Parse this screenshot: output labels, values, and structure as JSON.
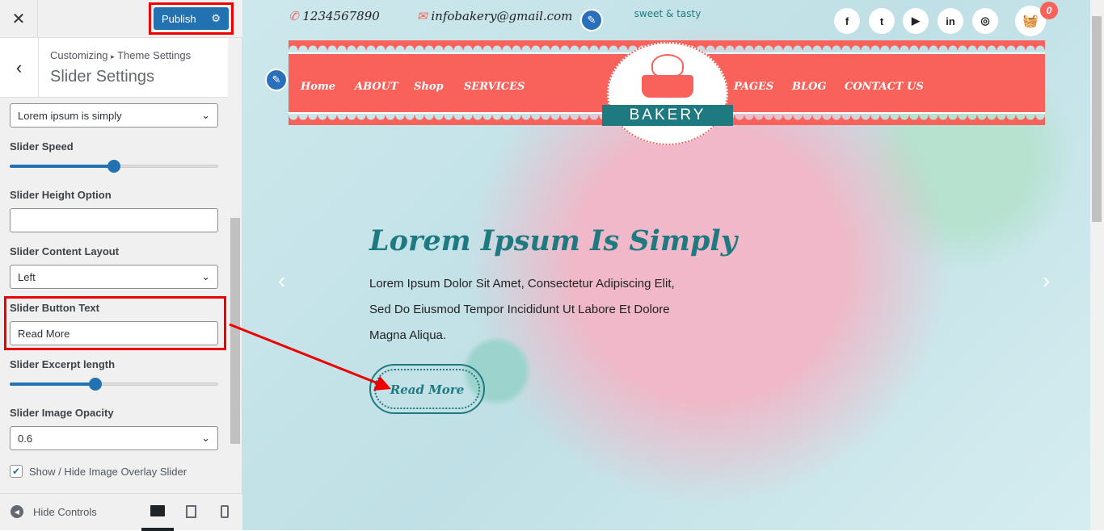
{
  "customizer": {
    "close_label": "✕",
    "publish_label": "Publish",
    "breadcrumb_root": "Customizing",
    "breadcrumb_sep": "▸",
    "breadcrumb_parent": "Theme Settings",
    "section_title": "Slider Settings",
    "top_select_value": "Lorem ipsum is simply",
    "slider_speed_label": "Slider Speed",
    "slider_speed_percent": 50,
    "slider_height_label": "Slider Height Option",
    "slider_height_value": "",
    "content_layout_label": "Slider Content Layout",
    "content_layout_value": "Left",
    "button_text_label": "Slider Button Text",
    "button_text_value": "Read More",
    "excerpt_label": "Slider Excerpt length",
    "excerpt_percent": 41,
    "opacity_label": "Slider Image Opacity",
    "opacity_value": "0.6",
    "overlay_label": "Show / Hide Image Overlay Slider",
    "overlay_checked": true,
    "hide_controls_label": "Hide Controls"
  },
  "preview": {
    "phone": "1234567890",
    "email": "infobakery@gmail.com",
    "logo_tagline": "sweet & tasty",
    "logo_name": "BAKERY",
    "nav_left": [
      "Home",
      "ABOUT",
      "Shop",
      "SERVICES"
    ],
    "nav_right": [
      "PAGES",
      "BLOG",
      "CONTACT US"
    ],
    "social": [
      "f",
      "t",
      "▶",
      "in",
      "◎"
    ],
    "cart_count": "0",
    "slide_title": "Lorem Ipsum Is Simply",
    "slide_text_lines": [
      "Lorem Ipsum Dolor Sit Amet, Consectetur Adipiscing Elit,",
      "Sed Do Eiusmod Tempor Incididunt Ut Labore Et Dolore",
      "Magna Aliqua."
    ],
    "slide_button": "Read More",
    "prev": "‹",
    "next": "›"
  },
  "colors": {
    "accent": "#2271b1",
    "brand": "#f9625a",
    "teal": "#1e7a80",
    "highlight": "#ee0000"
  }
}
